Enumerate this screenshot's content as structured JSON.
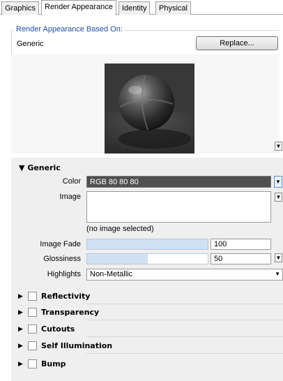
{
  "tabs": [
    {
      "label": "Graphics"
    },
    {
      "label": "Render Appearance"
    },
    {
      "label": "Identity"
    },
    {
      "label": "Physical"
    }
  ],
  "based_on": {
    "legend": "Render Appearance Based On:",
    "value": "Generic",
    "replace_label": "Replace..."
  },
  "generic": {
    "title": "Generic",
    "color_label": "Color",
    "color_value": "RGB 80 80 80",
    "image_label": "Image",
    "no_image_text": "(no image selected)",
    "image_fade_label": "Image Fade",
    "image_fade_value": "100",
    "glossiness_label": "Glossiness",
    "glossiness_value": "50",
    "highlights_label": "Highlights",
    "highlights_value": "Non-Metallic"
  },
  "sections": [
    {
      "label": "Reflectivity"
    },
    {
      "label": "Transparency"
    },
    {
      "label": "Cutouts"
    },
    {
      "label": "Self Illumination"
    },
    {
      "label": "Bump"
    }
  ],
  "colors": {
    "legend_blue": "#1f4fa8",
    "swatch": "#505050",
    "panel_gray": "#efefef",
    "slider_fill": "#cfe1f5"
  }
}
